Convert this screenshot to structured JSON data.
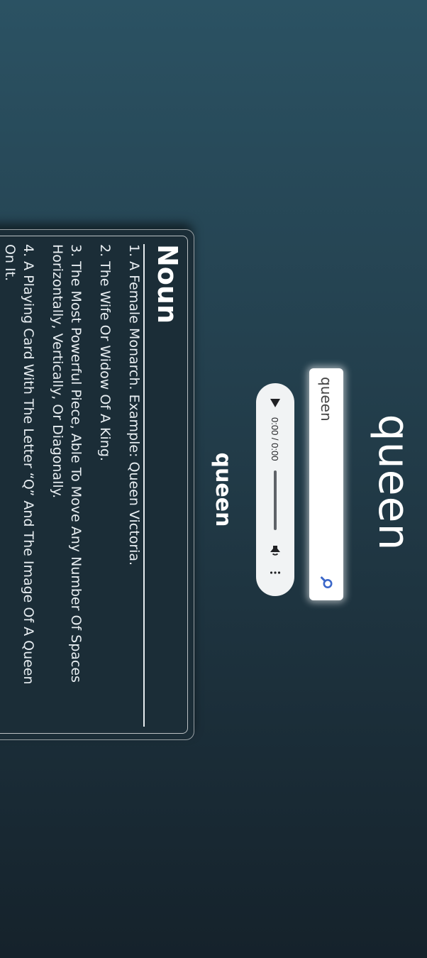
{
  "word": {
    "title": "queen",
    "subtitle": "queen"
  },
  "search": {
    "value": "queen",
    "icon": "search-icon",
    "accent_color": "#3b67c9"
  },
  "audio": {
    "time": "0:00 / 0:00",
    "progress": 0,
    "icons": [
      "play-icon",
      "volume-icon",
      "more-options-icon"
    ]
  },
  "meanings": [
    {
      "part_of_speech": "Noun",
      "definitions": [
        "1. A Female Monarch. Example: Queen Victoria.",
        "2. The Wife Or Widow Of A King.",
        "3. The Most Powerful Piece, Able To Move Any Number Of Spaces Horizontally, Vertically, Or Diagonally.",
        "4. A Playing Card With The Letter “Q” And The Image Of A Queen On It."
      ]
    }
  ],
  "colors": {
    "background_top": "#2b5263",
    "background_bottom": "#15222b",
    "text": "#ffffff"
  }
}
